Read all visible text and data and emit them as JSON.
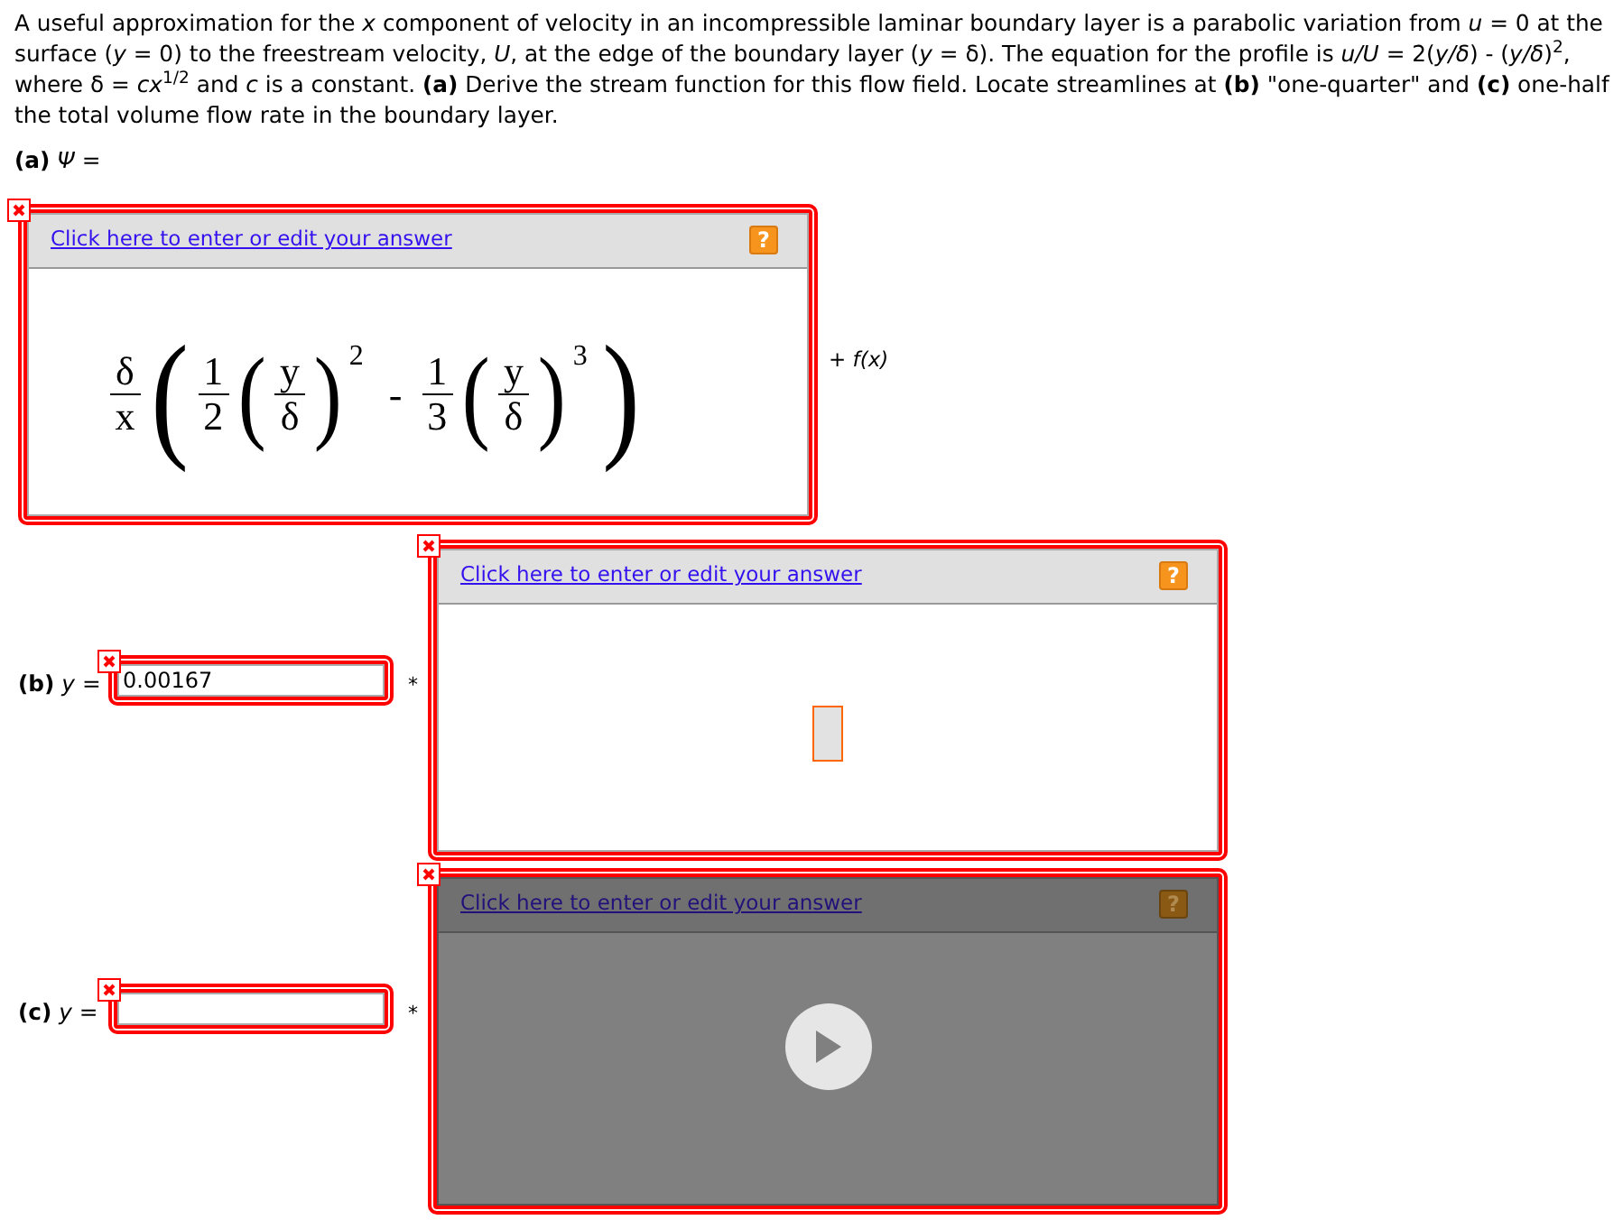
{
  "problem": "A useful approximation for the *x* component of velocity in an incompressible laminar boundary layer is a parabolic variation from *u* = 0 at the surface (*y* = 0) to the freestream velocity, *U*, at the edge of the boundary layer (*y* = δ). The equation for the profile is *u/U* = 2(*y/δ*) - (*y/δ*)$^{2}$, where δ = *cx*$^{1/2}$ and *c* is a constant. **(a)** Derive the stream function for this flow field. Locate streamlines at **(b)** \"one-quarter\" and **(c)** one-half the total volume flow rate in the boundary layer.",
  "part_a": {
    "label": "**(a)** *Ψ* =",
    "editor": {
      "kind": "math",
      "marked_wrong": true,
      "link": "Click here to enter or edit your answer",
      "help": "?",
      "math": {
        "lead": {
          "num": "δ",
          "den": "x"
        },
        "open": "(",
        "close": ")",
        "terms": [
          {
            "coef": {
              "num": "1",
              "den": "2"
            },
            "open": "(",
            "base": {
              "num": "y",
              "den": "δ"
            },
            "close": ")",
            "exponent": "2"
          },
          {
            "operator": "-",
            "coef": {
              "num": "1",
              "den": "3"
            },
            "open": "(",
            "base": {
              "num": "y",
              "den": "δ"
            },
            "close": ")",
            "exponent": "3"
          }
        ]
      }
    },
    "suffix": "+ *f(x)*"
  },
  "part_b": {
    "label": "**(b)** *y* =",
    "input": {
      "value": "0.00167",
      "marked_wrong": true
    },
    "unit": "*",
    "editor": {
      "kind": "empty",
      "marked_wrong": true,
      "link": "Click here to enter or edit your answer",
      "help": "?"
    }
  },
  "part_c": {
    "label": "**(c)** *y* =",
    "input": {
      "marked_wrong": true
    },
    "unit": "*",
    "editor": {
      "kind": "media",
      "marked_wrong": true,
      "link": "Click here to enter or edit your answer",
      "help": "?"
    }
  }
}
